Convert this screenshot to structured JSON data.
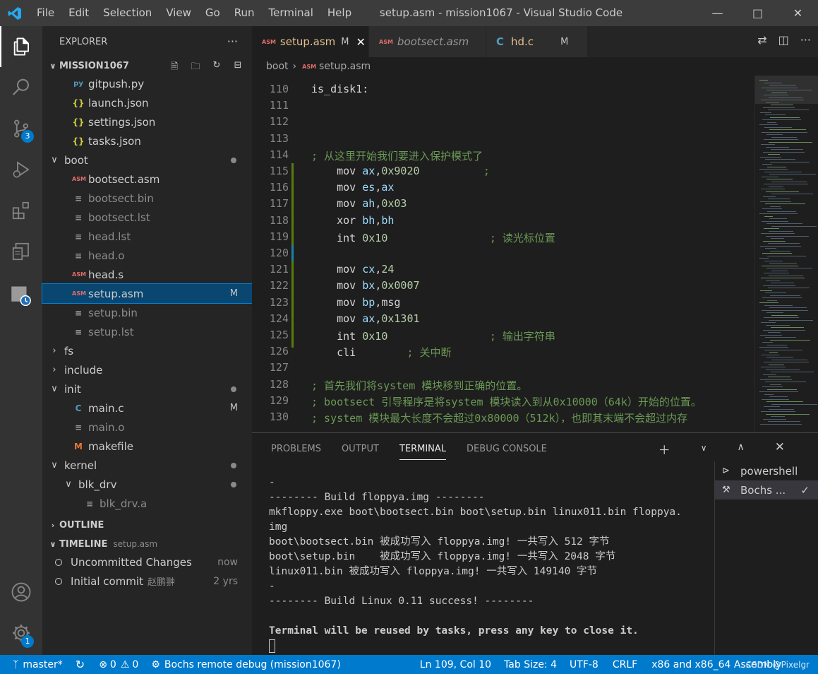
{
  "window": {
    "title": "setup.asm - mission1067 - Visual Studio Code",
    "menu": [
      "File",
      "Edit",
      "Selection",
      "View",
      "Go",
      "Run",
      "Terminal",
      "Help"
    ]
  },
  "activity": {
    "items": [
      "explorer-icon",
      "search-icon",
      "source-control-icon",
      "run-debug-icon",
      "extensions-icon",
      "remote-explorer-icon",
      "timeline-icon"
    ],
    "scm_badge": "3",
    "settings_badge": "1"
  },
  "explorer": {
    "header": "EXPLORER",
    "more": "···",
    "project": "MISSION1067",
    "files": [
      {
        "name": "gitpush.py",
        "icon": "python",
        "indent": 1
      },
      {
        "name": "launch.json",
        "icon": "json",
        "indent": 1
      },
      {
        "name": "settings.json",
        "icon": "json",
        "indent": 1
      },
      {
        "name": "tasks.json",
        "icon": "json",
        "indent": 1
      },
      {
        "name": "boot",
        "icon": "folder-open",
        "indent": 0,
        "dot": true
      },
      {
        "name": "bootsect.asm",
        "icon": "asm",
        "indent": 1
      },
      {
        "name": "bootsect.bin",
        "icon": "file",
        "indent": 1,
        "dim": true
      },
      {
        "name": "bootsect.lst",
        "icon": "file",
        "indent": 1,
        "dim": true
      },
      {
        "name": "head.lst",
        "icon": "file",
        "indent": 1,
        "dim": true
      },
      {
        "name": "head.o",
        "icon": "file",
        "indent": 1,
        "dim": true
      },
      {
        "name": "head.s",
        "icon": "asm",
        "indent": 1
      },
      {
        "name": "setup.asm",
        "icon": "asm",
        "indent": 1,
        "mark": "M",
        "selected": true
      },
      {
        "name": "setup.bin",
        "icon": "file",
        "indent": 1,
        "dim": true
      },
      {
        "name": "setup.lst",
        "icon": "file",
        "indent": 1,
        "dim": true
      },
      {
        "name": "fs",
        "icon": "folder-closed",
        "indent": 0
      },
      {
        "name": "include",
        "icon": "folder-closed",
        "indent": 0
      },
      {
        "name": "init",
        "icon": "folder-open",
        "indent": 0,
        "dot": true
      },
      {
        "name": "main.c",
        "icon": "c",
        "indent": 1,
        "mark": "M"
      },
      {
        "name": "main.o",
        "icon": "file",
        "indent": 1,
        "dim": true
      },
      {
        "name": "makefile",
        "icon": "makefile",
        "indent": 1
      },
      {
        "name": "kernel",
        "icon": "folder-open",
        "indent": 0,
        "dot": true
      },
      {
        "name": "blk_drv",
        "icon": "folder-open",
        "indent": 1,
        "dot": true
      },
      {
        "name": "blk_drv.a",
        "icon": "file",
        "indent": 2,
        "dim": true
      }
    ],
    "outline": "OUTLINE",
    "timeline": "TIMELINE",
    "timeline_file": "setup.asm",
    "commits": [
      {
        "label": "Uncommitted Changes",
        "author": "",
        "when": "now"
      },
      {
        "label": "Initial commit",
        "author": "赵鹏翀",
        "when": "2 yrs"
      }
    ]
  },
  "tabs": [
    {
      "name": "setup.asm",
      "tag": "ASM",
      "mark": "M",
      "active": true
    },
    {
      "name": "bootsect.asm",
      "tag": "ASM",
      "mark": "",
      "active": false
    },
    {
      "name": "hd.c",
      "tag": "C",
      "mark": "M",
      "active": false
    }
  ],
  "breadcrumb": {
    "folder": "boot",
    "file": "setup.asm"
  },
  "code_lines": [
    {
      "n": "110",
      "parts": [
        [
          "lbl",
          "is_disk1:"
        ]
      ]
    },
    {
      "n": "111",
      "parts": []
    },
    {
      "n": "112",
      "parts": []
    },
    {
      "n": "113",
      "parts": []
    },
    {
      "n": "114",
      "parts": [
        [
          "cm",
          "; 从这里开始我们要进入保护模式了"
        ]
      ]
    },
    {
      "n": "115",
      "parts": [
        [
          "kw",
          "    mov "
        ],
        [
          "reg",
          "ax"
        ],
        [
          "kw",
          ","
        ],
        [
          "num",
          "0x9020"
        ],
        [
          "cm",
          "          ;"
        ]
      ]
    },
    {
      "n": "116",
      "parts": [
        [
          "kw",
          "    mov "
        ],
        [
          "reg",
          "es"
        ],
        [
          "kw",
          ","
        ],
        [
          "reg",
          "ax"
        ]
      ]
    },
    {
      "n": "117",
      "parts": [
        [
          "kw",
          "    mov "
        ],
        [
          "reg",
          "ah"
        ],
        [
          "kw",
          ","
        ],
        [
          "num",
          "0x03"
        ]
      ]
    },
    {
      "n": "118",
      "parts": [
        [
          "kw",
          "    xor "
        ],
        [
          "reg",
          "bh"
        ],
        [
          "kw",
          ","
        ],
        [
          "reg",
          "bh"
        ]
      ]
    },
    {
      "n": "119",
      "parts": [
        [
          "kw",
          "    int "
        ],
        [
          "num",
          "0x10"
        ],
        [
          "cm",
          "                ; 读光标位置"
        ]
      ]
    },
    {
      "n": "120",
      "parts": []
    },
    {
      "n": "121",
      "parts": [
        [
          "kw",
          "    mov "
        ],
        [
          "reg",
          "cx"
        ],
        [
          "kw",
          ","
        ],
        [
          "num",
          "24"
        ]
      ]
    },
    {
      "n": "122",
      "parts": [
        [
          "kw",
          "    mov "
        ],
        [
          "reg",
          "bx"
        ],
        [
          "kw",
          ","
        ],
        [
          "num",
          "0x0007"
        ]
      ]
    },
    {
      "n": "123",
      "parts": [
        [
          "kw",
          "    mov "
        ],
        [
          "reg",
          "bp"
        ],
        [
          "kw",
          ",msg"
        ]
      ]
    },
    {
      "n": "124",
      "parts": [
        [
          "kw",
          "    mov "
        ],
        [
          "reg",
          "ax"
        ],
        [
          "kw",
          ","
        ],
        [
          "num",
          "0x1301"
        ]
      ]
    },
    {
      "n": "125",
      "parts": [
        [
          "kw",
          "    int "
        ],
        [
          "num",
          "0x10"
        ],
        [
          "cm",
          "                ; 输出字符串"
        ]
      ]
    },
    {
      "n": "126",
      "parts": [
        [
          "kw",
          "    cli"
        ],
        [
          "cm",
          "        ; 关中断"
        ]
      ]
    },
    {
      "n": "127",
      "parts": []
    },
    {
      "n": "128",
      "parts": [
        [
          "cm",
          "; 首先我们将system 模块移到正确的位置。"
        ]
      ]
    },
    {
      "n": "129",
      "parts": [
        [
          "cm",
          "; bootsect 引导程序是将system 模块读入到从0x10000（64k）开始的位置。"
        ]
      ]
    },
    {
      "n": "130",
      "parts": [
        [
          "cm",
          "; system 模块最大长度不会超过0x80000（512k），也即其末端不会超过内存"
        ]
      ]
    }
  ],
  "panel": {
    "tabs": [
      "PROBLEMS",
      "OUTPUT",
      "TERMINAL",
      "DEBUG CONSOLE"
    ],
    "active": "TERMINAL",
    "terminal_lines": [
      {
        "t": "-",
        "b": false
      },
      {
        "t": "-------- Build floppya.img --------",
        "b": false
      },
      {
        "t": "mkfloppy.exe boot\\bootsect.bin boot\\setup.bin linux011.bin floppya.",
        "b": false
      },
      {
        "t": "img",
        "b": false
      },
      {
        "t": "boot\\bootsect.bin 被成功写入 floppya.img! 一共写入 512 字节",
        "b": false
      },
      {
        "t": "boot\\setup.bin    被成功写入 floppya.img! 一共写入 2048 字节",
        "b": false
      },
      {
        "t": "linux011.bin 被成功写入 floppya.img! 一共写入 149140 字节",
        "b": false
      },
      {
        "t": "-",
        "b": false
      },
      {
        "t": "-------- Build Linux 0.11 success! --------",
        "b": false
      },
      {
        "t": "",
        "b": false
      },
      {
        "t": "Terminal will be reused by tasks, press any key to close it.",
        "b": true
      }
    ],
    "terminals": [
      {
        "name": "powershell",
        "active": false
      },
      {
        "name": "Bochs ...",
        "active": true
      }
    ]
  },
  "status": {
    "branch": "master*",
    "errors": "0",
    "warnings": "0",
    "debug": "Bochs remote debug (mission1067)",
    "position": "Ln 109, Col 10",
    "tab_size": "Tab Size: 4",
    "encoding": "UTF-8",
    "eol": "CRLF",
    "language": "x86 and x86_64 Assembly",
    "watermark": "CSDN @Pixelgr"
  }
}
